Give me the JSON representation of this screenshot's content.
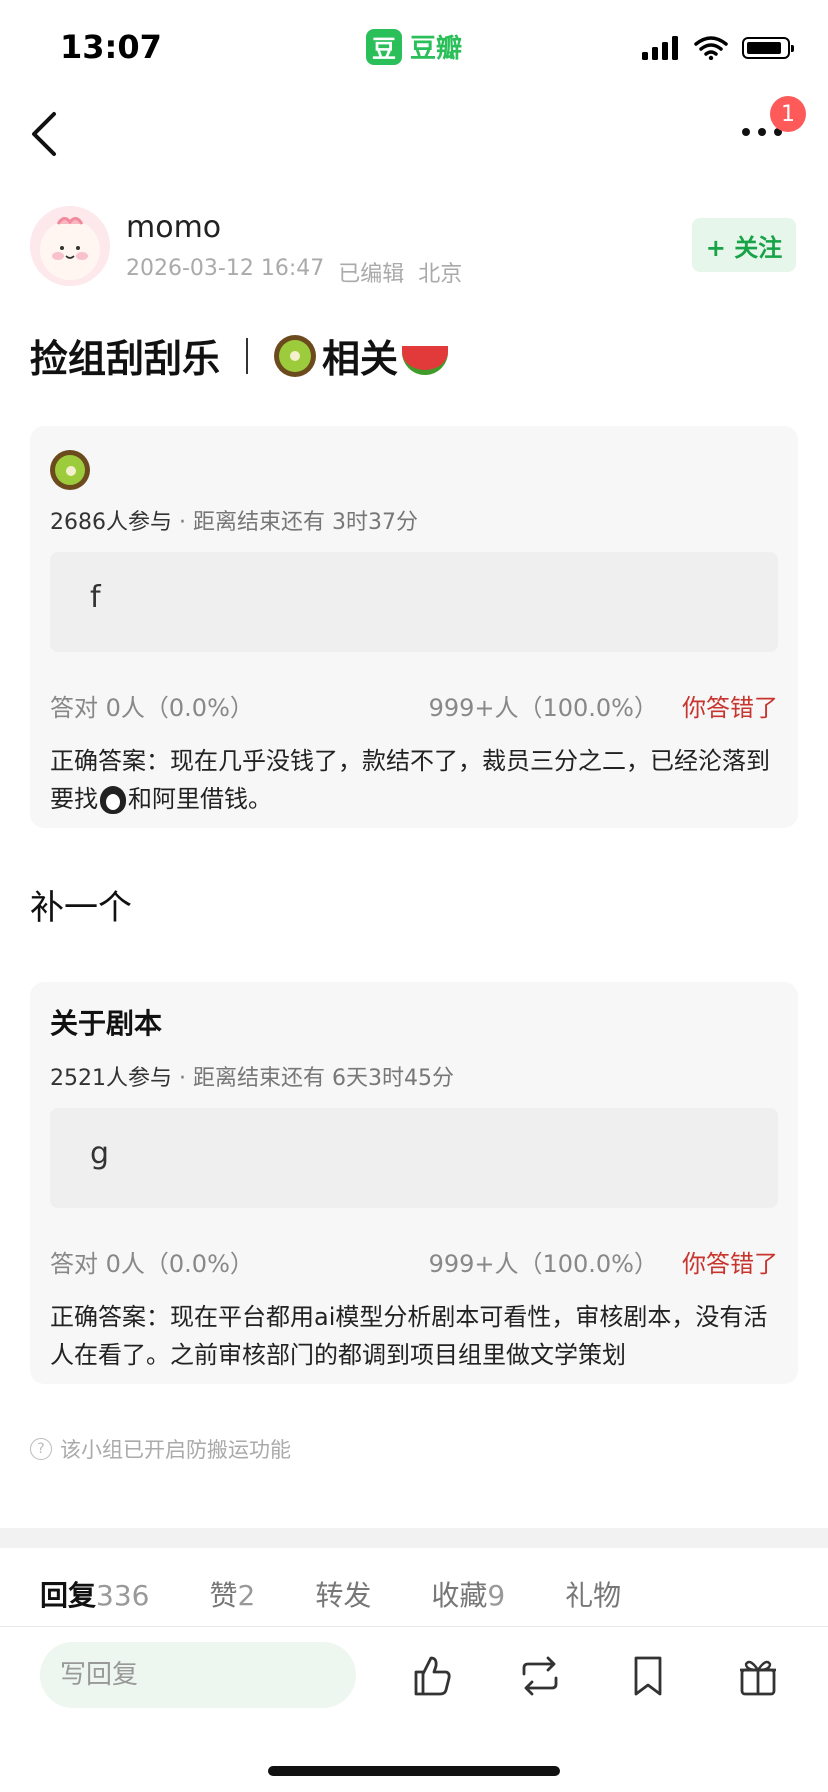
{
  "status_bar": {
    "time": "13:07"
  },
  "app": {
    "logo_char": "豆",
    "name": "豆瓣"
  },
  "nav": {
    "notification_count": "1"
  },
  "author": {
    "name": "momo",
    "date": "2026-03-12 16:47",
    "edited": "已编辑",
    "location": "北京",
    "follow_label": "+ 关注"
  },
  "post": {
    "title_left": "捡组刮刮乐",
    "title_right": "相关"
  },
  "polls": [
    {
      "title": "",
      "icon": "kiwi-icon",
      "participants": "2686人参与",
      "remaining": " · 距离结束还有 3时37分",
      "option": "f",
      "correct_stat": "答对  0人（0.0%）",
      "other_stat": "999+人（100.0%）",
      "result": "你答错了",
      "answer_a": "正确答案：现在几乎没钱了，款结不了，裁员三分之二，已经沦落到要找",
      "answer_b": "和阿里借钱。"
    },
    {
      "title": "关于剧本",
      "participants": "2521人参与",
      "remaining": " · 距离结束还有 6天3时45分",
      "option": "g",
      "correct_stat": "答对  0人（0.0%）",
      "other_stat": "999+人（100.0%）",
      "result": "你答错了",
      "answer": "正确答案：现在平台都用ai模型分析剧本可看性，审核剧本，没有活人在看了。之前审核部门的都调到项目组里做文学策划"
    }
  ],
  "interstitial": "补一个",
  "footer_note": "该小组已开启防搬运功能",
  "tabs": [
    {
      "label": "回复",
      "count": "336"
    },
    {
      "label": "赞",
      "count": "2"
    },
    {
      "label": "转发",
      "count": ""
    },
    {
      "label": "收藏",
      "count": "9"
    },
    {
      "label": "礼物",
      "count": ""
    }
  ],
  "reply": {
    "placeholder": "写回复"
  },
  "colors": {
    "brand": "#2bbf5a",
    "wrong": "#c8352e",
    "badge": "#ff5a5a"
  }
}
